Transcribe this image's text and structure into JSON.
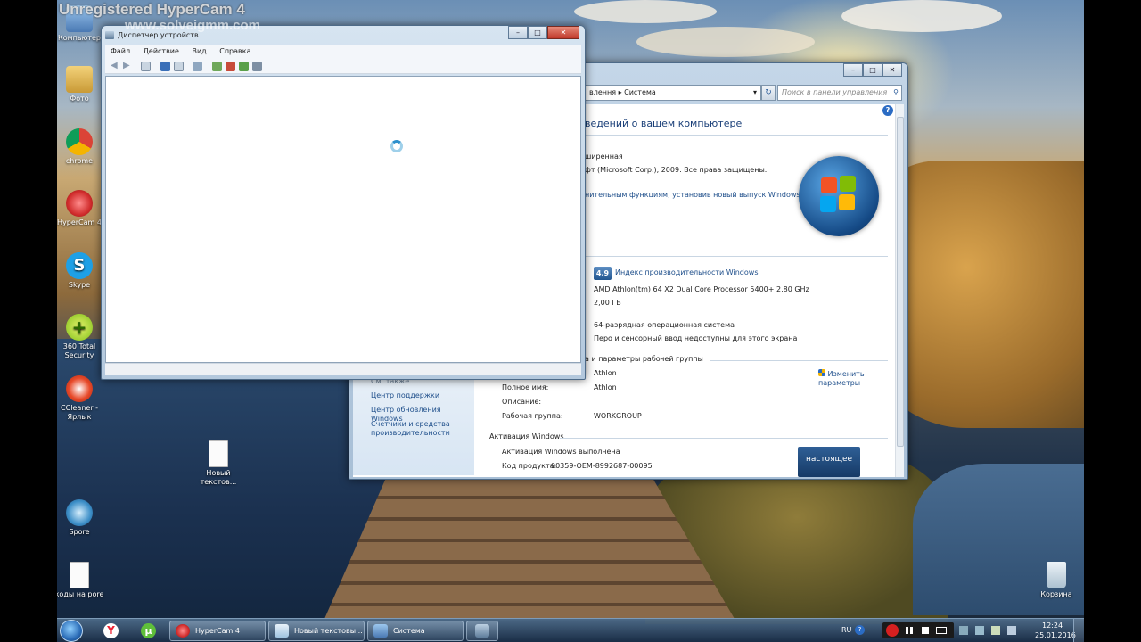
{
  "watermark": {
    "line1": "Unregistered HyperCam 4",
    "line2": "www.solveigmm.com"
  },
  "desktop_icons": [
    {
      "label": "Компьютер"
    },
    {
      "label": "Фото"
    },
    {
      "label": "chrome"
    },
    {
      "label": "HyperCam 4"
    },
    {
      "label": "Skype"
    },
    {
      "label": "360 Total Security"
    },
    {
      "label": "CCleaner - Ярлык"
    },
    {
      "label": "Новый текстов..."
    },
    {
      "label": "Spore"
    },
    {
      "label": "коды на pore"
    },
    {
      "label": "Корзина"
    }
  ],
  "device_manager": {
    "title": "Диспетчер устройств",
    "menu": [
      "Файл",
      "Действие",
      "Вид",
      "Справка"
    ]
  },
  "system_window": {
    "address": "влення ▸ Система",
    "search_placeholder": "Поиск в панели управления",
    "heading": "ведений о вашем компьютере",
    "edition": "шиpенная",
    "copyright": "фт (Microsoft Corp.), 2009. Все права защищены.",
    "upgrade_link": "нительным функциям, установив новый выпуск Windows 7",
    "rating_score": "4,9",
    "rating_link": "Индекс производительности Windows",
    "processor": "AMD Athlon(tm) 64 X2 Dual Core Processor 5400+   2.80 GHz",
    "memory": "2,00 ГБ",
    "system_type": "64-разрядная операционная система",
    "pen_touch": "Перо и сенсорный ввод недоступны для этого экрана",
    "workgroup_section": "а и параметры рабочей группы",
    "computer_name": "Athlon",
    "full_name_label": "Полное имя:",
    "full_name": "Athlon",
    "description_label": "Описание:",
    "workgroup_label": "Рабочая группа:",
    "workgroup": "WORKGROUP",
    "change_settings": "Изменить параметры",
    "activation_section": "Активация Windows",
    "activation_status": "Активация Windows выполнена",
    "product_key_label": "Код продукта:",
    "product_key": "00359-OEM-8992687-00095",
    "genuine_badge": "настоящее",
    "see_also": "См. также",
    "links": [
      "Центр поддержки",
      "Центр обновления Windows",
      "Счетчики и средства производительности"
    ]
  },
  "taskbar": {
    "tasks": [
      "HyperCam 4",
      "Новый текстовы...",
      "Система"
    ],
    "lang": "RU",
    "time": "12:24",
    "date": "25.01.2016"
  },
  "colors": {
    "accent": "#1f4f8b",
    "close": "#c0392b"
  }
}
